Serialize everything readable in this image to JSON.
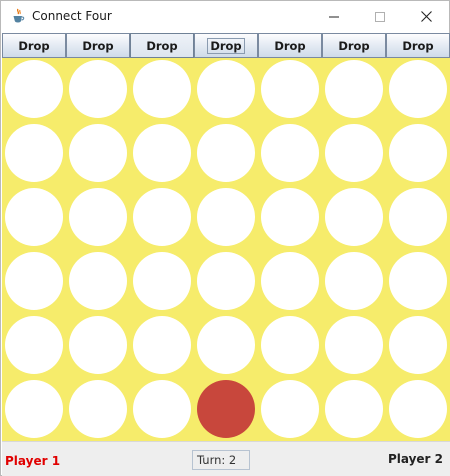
{
  "window": {
    "title": "Connect Four",
    "icon": "java-cup-icon"
  },
  "controls": {
    "minimize_icon": "minimize-icon",
    "maximize_icon": "maximize-icon",
    "close_icon": "close-icon"
  },
  "toolbar": {
    "drop_buttons": [
      "Drop",
      "Drop",
      "Drop",
      "Drop",
      "Drop",
      "Drop",
      "Drop"
    ]
  },
  "board": {
    "rows": 6,
    "columns": 7,
    "background_color": "#f6ec6b",
    "empty_color": "#ffffff",
    "player1_color": "#c8473c",
    "pieces": [
      {
        "row": 6,
        "column": 4,
        "player": "Player 1"
      }
    ]
  },
  "status": {
    "player1_label": "Player 1",
    "player1_color": "#e00000",
    "turn_text": "Turn: 2",
    "player2_label": "Player 2"
  }
}
